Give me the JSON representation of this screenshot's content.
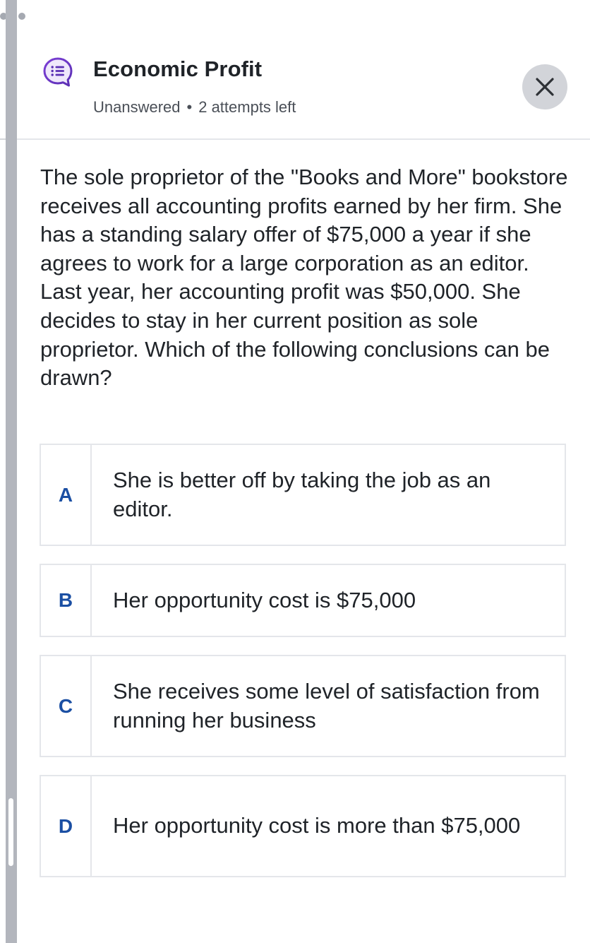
{
  "header": {
    "title": "Economic Profit",
    "status": "Unanswered",
    "separator": "•",
    "attempts": "2 attempts left"
  },
  "question": {
    "text": "The sole proprietor of the \"Books and More\" bookstore receives all accounting profits earned by her firm. She has a standing salary offer of $75,000 a year if she agrees to work for a large corporation as an editor. Last year, her accounting profit was $50,000. She decides to stay in her current position as sole proprietor. Which of the following conclusions can be drawn?"
  },
  "options": [
    {
      "letter": "A",
      "text": "She is better off by taking the job as an editor."
    },
    {
      "letter": "B",
      "text": "Her opportunity cost is $75,000"
    },
    {
      "letter": "C",
      "text": "She receives some level of satisfaction from running her business"
    },
    {
      "letter": "D",
      "text": "Her opportunity cost is more than $75,000"
    }
  ],
  "icons": {
    "question_icon": "chat-bubble-list-icon",
    "close_icon": "close-icon"
  },
  "colors": {
    "accent_purple": "#6a3bc4",
    "letter_blue": "#1b4fa3",
    "close_bg": "#d2d4d9"
  }
}
